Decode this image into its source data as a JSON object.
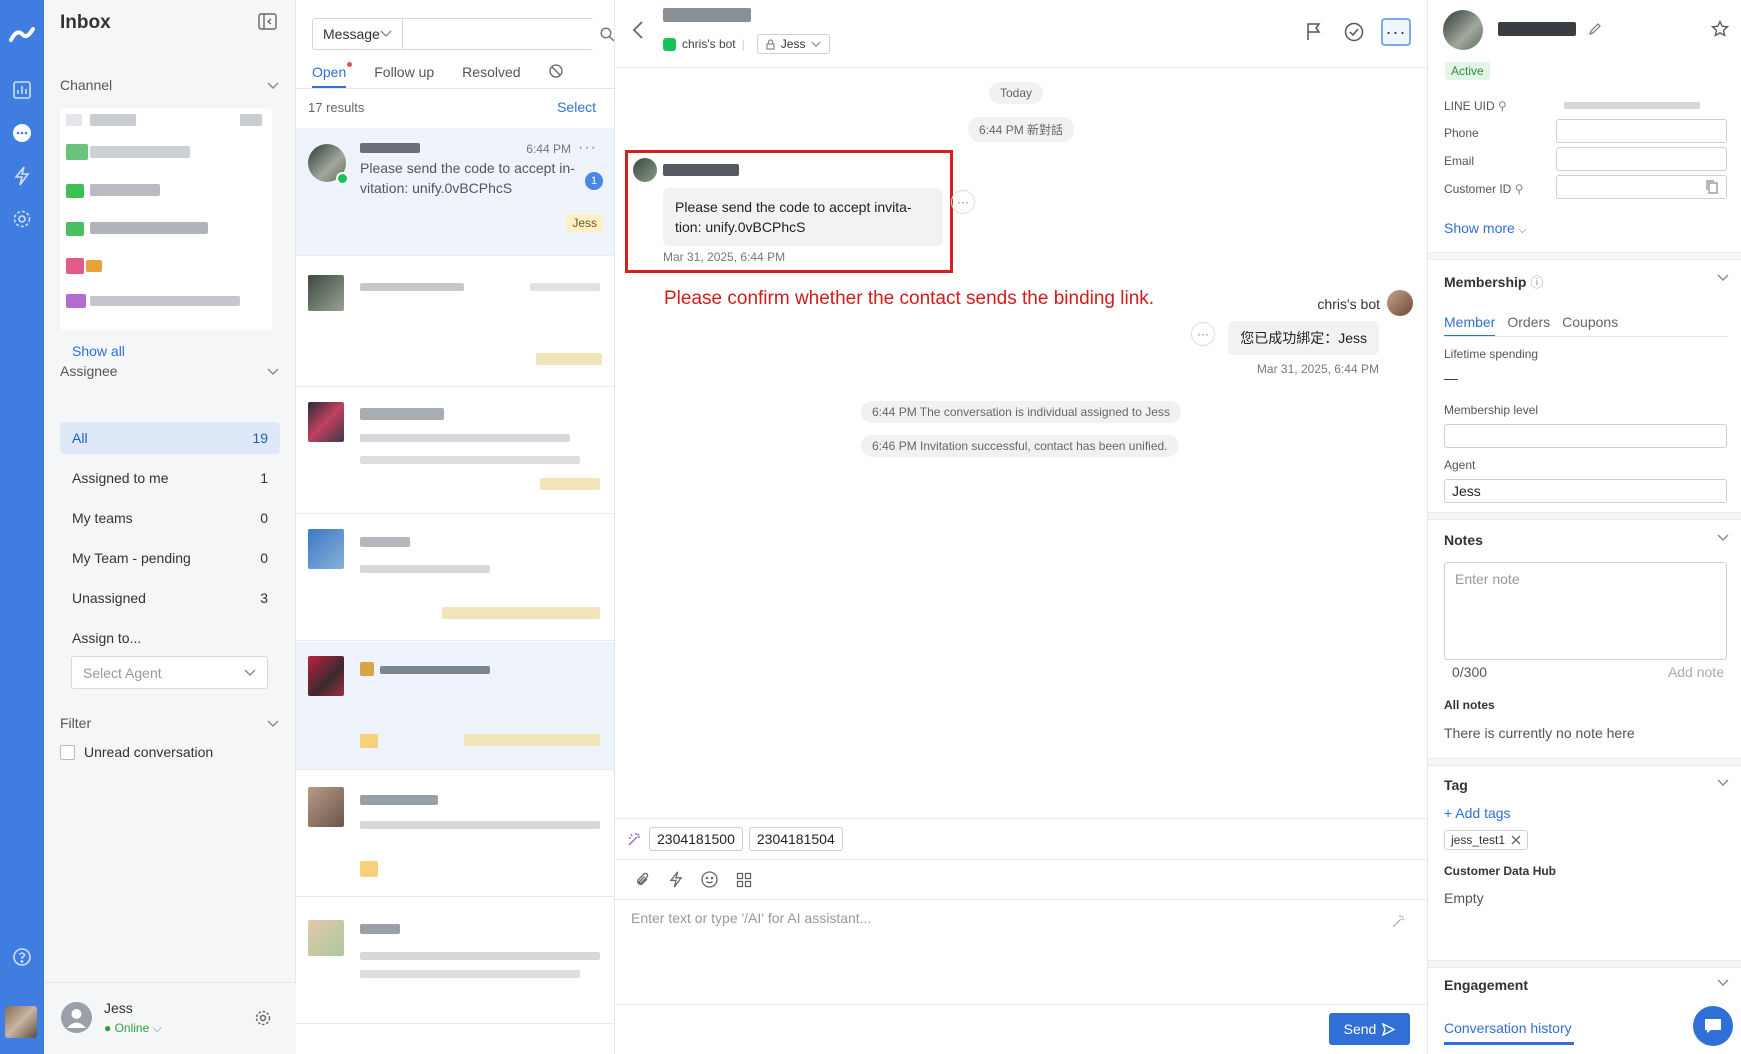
{
  "colors": {
    "primary": "#2f6fd6",
    "rail": "#3f7ee0",
    "annotation_red": "#d21b1b",
    "active_green": "#2e8a3e"
  },
  "rail": {
    "icons": [
      "logo-icon",
      "chart-icon",
      "chat-icon",
      "bolt-icon",
      "gear-icon",
      "help-icon"
    ]
  },
  "sidebar": {
    "title": "Inbox",
    "channel_label": "Channel",
    "show_all": "Show all",
    "assignee_label": "Assignee",
    "assignee_items": [
      {
        "label": "All",
        "count": "19"
      },
      {
        "label": "Assigned to me",
        "count": "1"
      },
      {
        "label": "My teams",
        "count": "0"
      },
      {
        "label": "My Team - pending",
        "count": "0"
      },
      {
        "label": "Unassigned",
        "count": "3"
      }
    ],
    "assign_to": "Assign to...",
    "select_agent_placeholder": "Select Agent",
    "filter_label": "Filter",
    "unread_label": "Unread conversation",
    "user_name": "Jess",
    "user_status": "Online"
  },
  "conv_list": {
    "search_type": "Message",
    "search_value": "",
    "tabs": [
      "Open",
      "Follow up",
      "Resolved"
    ],
    "results": "17 results",
    "select": "Select",
    "first": {
      "time": "6:44 PM",
      "message": "Please send the code to accept in-vitation: unify.0vBCPhcS",
      "unread": "1",
      "tag": "Jess"
    }
  },
  "chat": {
    "bot_label": "chris's bot",
    "assignee": "Jess",
    "today": "Today",
    "new_conv": "6:44 PM 新對話",
    "incoming_message": "Please send the code to accept invita-tion: unify.0vBCPhcS",
    "incoming_time": "Mar 31, 2025, 6:44 PM",
    "annotation": "Please confirm whether the contact sends the binding link.",
    "bot_name": "chris's bot",
    "outgoing_message": "您已成功綁定：Jess",
    "outgoing_time": "Mar 31, 2025, 6:44 PM",
    "system_1": "6:44 PM The conversation is individual assigned to Jess",
    "system_2": "6:46 PM Invitation successful, contact has been unified.",
    "quick_chips": [
      "2304181500",
      "2304181504"
    ],
    "composer_placeholder": "Enter text or type '/AI' for AI assistant...",
    "send": "Send"
  },
  "profile": {
    "status": "Active",
    "fields": [
      "LINE UID",
      "Phone",
      "Email",
      "Customer ID"
    ],
    "show_more": "Show more",
    "membership_title": "Membership",
    "membership_tabs": [
      "Member",
      "Orders",
      "Coupons"
    ],
    "lifetime_spending_label": "Lifetime spending",
    "lifetime_spending_value": "—",
    "membership_level_label": "Membership level",
    "agent_label": "Agent",
    "agent_value": "Jess",
    "notes_title": "Notes",
    "notes_placeholder": "Enter note",
    "notes_count": "0/300",
    "add_note": "Add note",
    "all_notes": "All notes",
    "no_note": "There is currently no note here",
    "tag_title": "Tag",
    "add_tags": "+ Add tags",
    "tag_chip": "jess_test1",
    "cdh_label": "Customer Data Hub",
    "cdh_value": "Empty",
    "engagement_title": "Engagement",
    "conversation_history": "Conversation history"
  }
}
